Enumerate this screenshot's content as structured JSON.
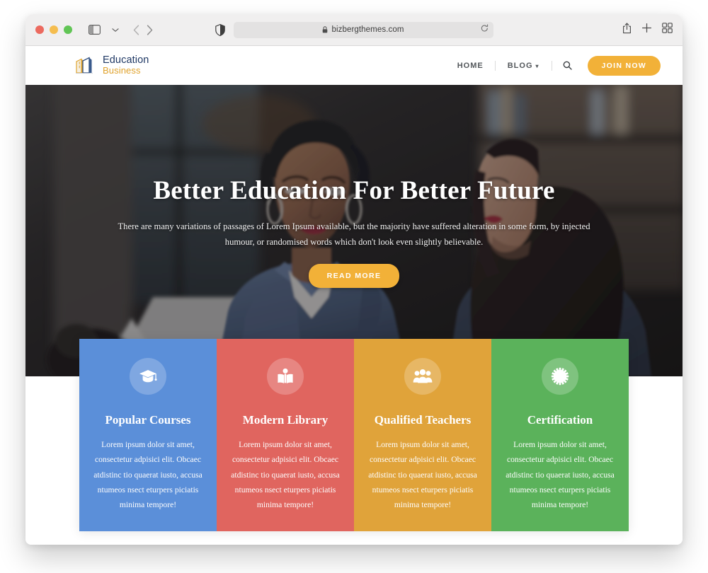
{
  "browser": {
    "url": "bizbergthemes.com",
    "lock_icon": "lock-icon",
    "reload_icon": "reload-icon",
    "shield_icon": "privacy-shield-icon",
    "sidebar_icon": "sidebar-toggle-icon",
    "back_icon": "back-arrow-icon",
    "forward_icon": "forward-arrow-icon",
    "share_icon": "share-icon",
    "new_tab_icon": "plus-icon",
    "tab_overview_icon": "tab-overview-icon",
    "traffic_lights": [
      "close",
      "minimize",
      "zoom"
    ]
  },
  "site": {
    "logo": {
      "line1": "Education",
      "line2": "Business",
      "mark_icon": "building-book-logo-icon",
      "color_primary": "#1f3864",
      "color_accent": "#e0a32e"
    },
    "nav": {
      "items": [
        {
          "label": "HOME",
          "has_caret": false
        },
        {
          "label": "BLOG",
          "has_caret": true
        }
      ],
      "search_icon": "search-icon",
      "cta_label": "JOIN NOW",
      "cta_color": "#f2b138"
    }
  },
  "hero": {
    "title": "Better Education For Better Future",
    "subtitle": "There are many variations of passages of Lorem Ipsum available, but the majority have suffered alteration in some form, by injected humour, or randomised words which don't look even slightly believable.",
    "button_label": "READ MORE",
    "button_color": "#f2b138"
  },
  "features": {
    "cards": [
      {
        "title": "Popular Courses",
        "text": "Lorem ipsum dolor sit amet, consectetur adpisici elit. Obcaec atdistinc tio quaerat iusto, accusa ntumeos nsect eturpers piciatis minima tempore!",
        "icon": "graduation-cap-icon",
        "color": "#5b8fd9"
      },
      {
        "title": "Modern Library",
        "text": "Lorem ipsum dolor sit amet, consectetur adpisici elit. Obcaec atdistinc tio quaerat iusto, accusa ntumeos nsect eturpers piciatis minima tempore!",
        "icon": "open-book-reader-icon",
        "color": "#e0655f"
      },
      {
        "title": "Qualified Teachers",
        "text": "Lorem ipsum dolor sit amet, consectetur adpisici elit. Obcaec atdistinc tio quaerat iusto, accusa ntumeos nsect eturpers piciatis minima tempore!",
        "icon": "users-group-icon",
        "color": "#e0a33a"
      },
      {
        "title": "Certification",
        "text": "Lorem ipsum dolor sit amet, consectetur adpisici elit. Obcaec atdistinc tio quaerat iusto, accusa ntumeos nsect eturpers piciatis minima tempore!",
        "icon": "certificate-seal-icon",
        "color": "#5bb25b"
      }
    ]
  }
}
